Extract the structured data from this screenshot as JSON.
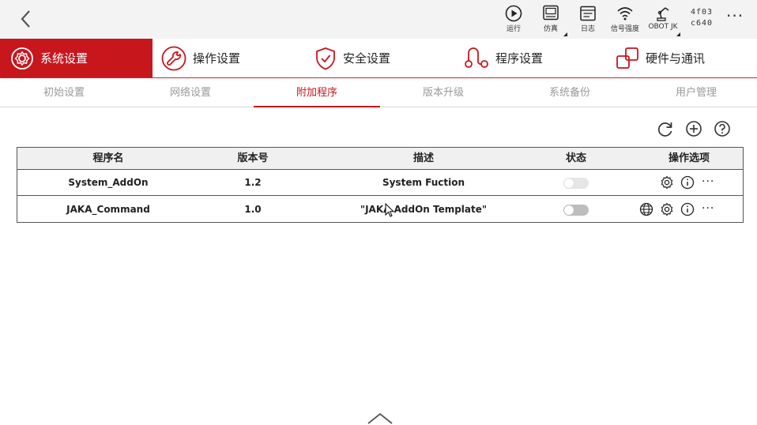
{
  "topbar": {
    "items": [
      {
        "label": "运行",
        "icon": "play-icon"
      },
      {
        "label": "仿真",
        "icon": "simulation-icon"
      },
      {
        "label": "日志",
        "icon": "log-icon"
      },
      {
        "label": "信号强度",
        "icon": "wifi-icon"
      },
      {
        "label": "OBOT JK",
        "icon": "robot-arm-icon"
      }
    ],
    "code_line1": "4f03",
    "code_line2": "c640",
    "more": "···"
  },
  "main_tabs": [
    {
      "label": "系统设置",
      "icon": "system-settings-icon",
      "active": true
    },
    {
      "label": "操作设置",
      "icon": "wrench-icon",
      "active": false
    },
    {
      "label": "安全设置",
      "icon": "shield-icon",
      "active": false
    },
    {
      "label": "程序设置",
      "icon": "program-icon",
      "active": false
    },
    {
      "label": "硬件与通讯",
      "icon": "hardware-icon",
      "active": false
    }
  ],
  "sub_tabs": [
    {
      "label": "初始设置",
      "active": false
    },
    {
      "label": "网络设置",
      "active": false
    },
    {
      "label": "附加程序",
      "active": true
    },
    {
      "label": "版本升级",
      "active": false
    },
    {
      "label": "系统备份",
      "active": false
    },
    {
      "label": "用户管理",
      "active": false
    }
  ],
  "toolbar": {
    "refresh_icon": "refresh-icon",
    "add_icon": "add-circle-icon",
    "help_icon": "help-icon"
  },
  "table": {
    "columns": [
      "程序名",
      "版本号",
      "描述",
      "状态",
      "操作选项"
    ],
    "rows": [
      {
        "name": "System_AddOn",
        "version": "1.2",
        "description": "System Fuction",
        "enabled": false,
        "ops": [
          "settings-icon",
          "info-icon",
          "more-icon"
        ]
      },
      {
        "name": "JAKA_Command",
        "version": "1.0",
        "description": "\"JAKA AddOn Template\"",
        "enabled": false,
        "ops": [
          "globe-icon",
          "settings-icon",
          "info-icon",
          "more-icon"
        ]
      }
    ],
    "more_glyph": "···"
  },
  "colors": {
    "accent": "#c8161d",
    "toggle_row1": "#e6e6e6",
    "toggle_row2": "#bdbdbd",
    "header_bg": "#f0f0f0",
    "topbar_bg": "#f3f3f3"
  }
}
